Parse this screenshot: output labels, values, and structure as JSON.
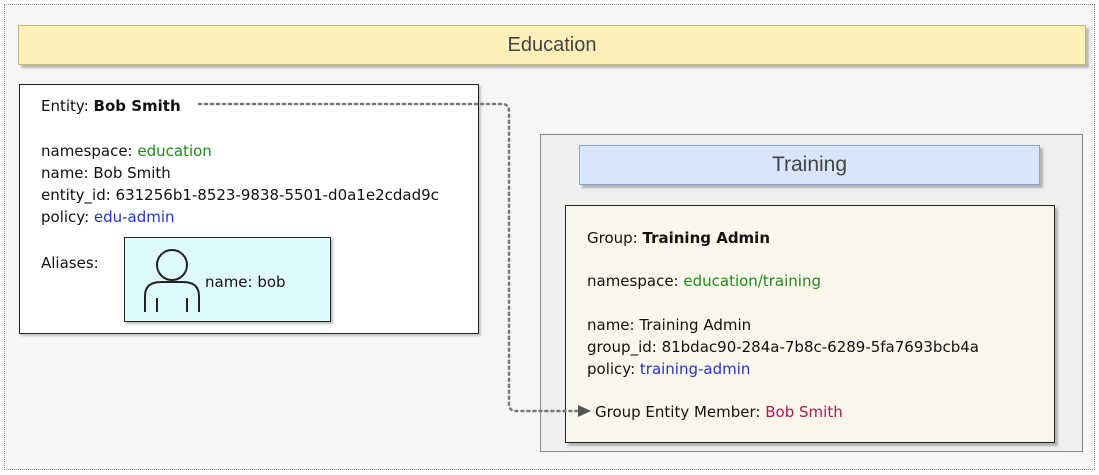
{
  "education": {
    "title": "Education"
  },
  "entity": {
    "heading_label": "Entity: ",
    "heading_name": "Bob Smith",
    "namespace_label": "namespace: ",
    "namespace_value": "education",
    "name_line": "name: Bob Smith",
    "entity_id_line": "entity_id: 631256b1-8523-9838-5501-d0a1e2cdad9c",
    "policy_label": "policy: ",
    "policy_value": "edu-admin",
    "aliases_label": "Aliases:",
    "alias_name": "name: bob"
  },
  "training": {
    "title": "Training"
  },
  "group": {
    "heading_label": "Group: ",
    "heading_name": "Training Admin",
    "namespace_label": "namespace: ",
    "namespace_value": "education/training",
    "name_line": "name: Training Admin",
    "group_id_line": "group_id: 81bdac90-284a-7b8c-6289-5fa7693bcb4a",
    "policy_label": "policy: ",
    "policy_value": "training-admin",
    "member_label": "Group Entity Member: ",
    "member_value": "Bob Smith"
  },
  "colors": {
    "education_banner": "#fcf0b8",
    "training_banner": "#d8e5fb",
    "alias_box": "#dffafc",
    "group_box": "#faf7ea",
    "namespace_text": "#1f8a1f",
    "policy_text": "#2233cc",
    "member_text": "#b2145a"
  },
  "icons": {
    "alias": "user-icon",
    "connector": "dotted-arrow"
  }
}
